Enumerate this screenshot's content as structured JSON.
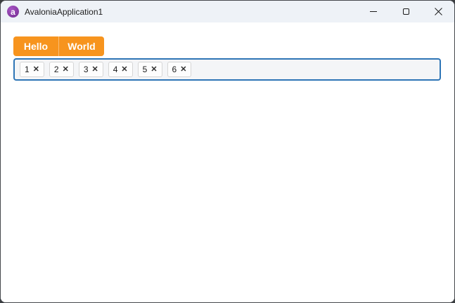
{
  "window": {
    "title": "AvaloniaApplication1",
    "app_icon": {
      "name": "avalonia-logo-icon",
      "glyph": "a"
    },
    "controls": [
      {
        "name": "minimize-button"
      },
      {
        "name": "maximize-button"
      },
      {
        "name": "close-button"
      }
    ]
  },
  "tabstrip": {
    "tabs": [
      {
        "label": "Hello"
      },
      {
        "label": "World"
      }
    ]
  },
  "chips": {
    "remove_glyph": "✕",
    "items": [
      {
        "label": "1"
      },
      {
        "label": "2"
      },
      {
        "label": "3"
      },
      {
        "label": "4"
      },
      {
        "label": "5"
      },
      {
        "label": "6"
      }
    ]
  },
  "colors": {
    "accent_orange": "#F7941E",
    "focus_border_blue": "#2E75B6",
    "titlebar_background": "#EEF2F7",
    "window_border": "#45484D"
  }
}
